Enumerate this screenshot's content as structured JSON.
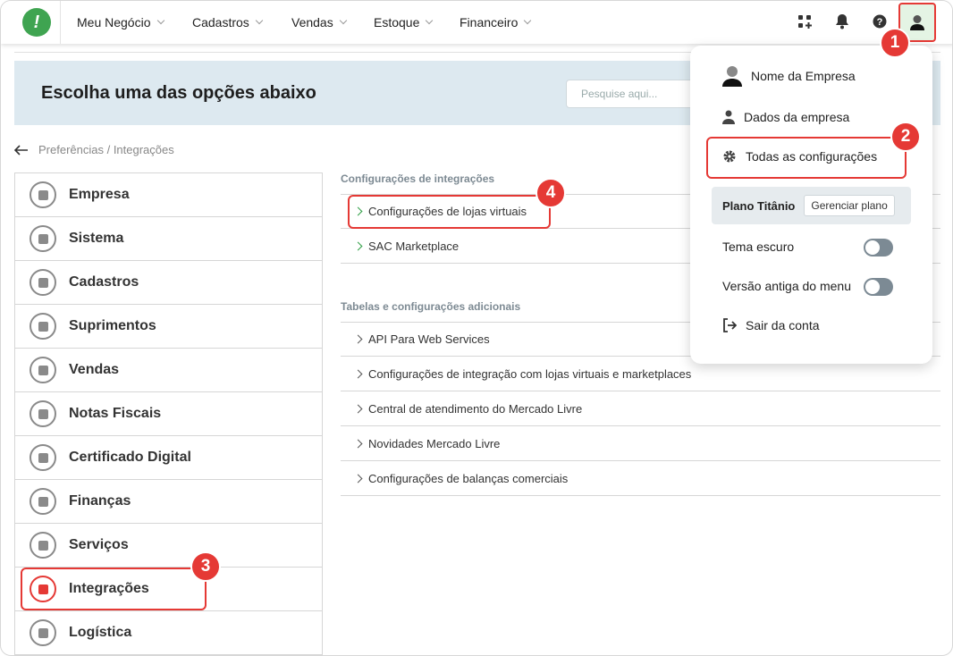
{
  "nav": {
    "items": [
      "Meu Negócio",
      "Cadastros",
      "Vendas",
      "Estoque",
      "Financeiro"
    ]
  },
  "banner": {
    "title": "Escolha uma das opções abaixo",
    "search_placeholder": "Pesquise aqui..."
  },
  "breadcrumb": "Preferências / Integrações",
  "categories": [
    {
      "label": "Empresa",
      "icon": "building-icon"
    },
    {
      "label": "Sistema",
      "icon": "monitor-icon"
    },
    {
      "label": "Cadastros",
      "icon": "book-icon"
    },
    {
      "label": "Suprimentos",
      "icon": "box-icon"
    },
    {
      "label": "Vendas",
      "icon": "people-icon"
    },
    {
      "label": "Notas Fiscais",
      "icon": "invoice-icon"
    },
    {
      "label": "Certificado Digital",
      "icon": "lock-icon"
    },
    {
      "label": "Finanças",
      "icon": "piggy-bank-icon"
    },
    {
      "label": "Serviços",
      "icon": "document-icon"
    },
    {
      "label": "Integrações",
      "icon": "integration-icon",
      "active": true
    },
    {
      "label": "Logística",
      "icon": "truck-icon"
    }
  ],
  "integrations_section": {
    "title": "Configurações de integrações",
    "items": [
      "Configurações de lojas virtuais",
      "SAC Marketplace"
    ]
  },
  "additional_section": {
    "title": "Tabelas e configurações adicionais",
    "items": [
      "API Para Web Services",
      "Configurações de integração com lojas virtuais e marketplaces",
      "Central de atendimento do Mercado Livre",
      "Novidades Mercado Livre",
      "Configurações de balanças comerciais"
    ]
  },
  "dropdown": {
    "company_name": "Nome da Empresa",
    "company_data": "Dados da empresa",
    "all_settings": "Todas as configurações",
    "plan_label": "Plano Titânio",
    "manage_plan": "Gerenciar plano",
    "dark_theme": "Tema escuro",
    "old_menu": "Versão antiga do menu",
    "logout": "Sair da conta"
  },
  "markers": [
    "1",
    "2",
    "3",
    "4"
  ],
  "colors": {
    "brand_green": "#3fa451",
    "highlight_red": "#e53935",
    "banner_bg": "#dde9f0"
  }
}
